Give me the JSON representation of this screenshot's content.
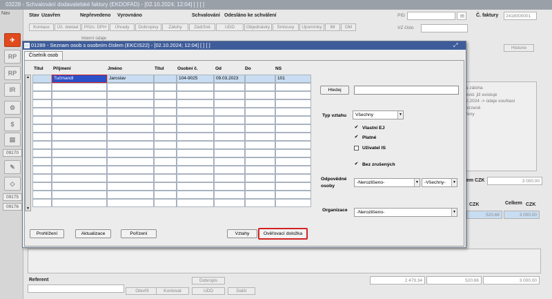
{
  "window_title": "03228 - Schvalování dodavatelské faktury (EKDOFAD) - [02.10.2024; 12:04] [ ] [ ]",
  "nav_label": "Nav",
  "nav_buttons": [
    "RP",
    "RP",
    "IR"
  ],
  "nav_numbers": [
    "09170",
    "09175",
    "09176"
  ],
  "status_labels": [
    "Stav",
    "Uzavřen",
    "Nepřevedeno",
    "Vyrovnáno",
    "Schvalování",
    "Odesláno ke schválení"
  ],
  "interni_udaje": "Interní údaje",
  "toolbar_buttons": [
    "Kontace",
    "Úč. doklad",
    "Přizn. DPH",
    "Úhrady",
    "Dobropisy",
    "Zálohy",
    "Zádržné",
    "UDD",
    "Objednávky",
    "Smlouvy",
    "Upomínky",
    "IM",
    "DM"
  ],
  "pid_label": "PID",
  "vz_label": "VZ číslo",
  "faktury_label": "Č. faktury",
  "faktury_value": "2418000001",
  "historie_button": "Historie",
  "right_notes": [
    "a záloha",
    "evid. již existuje",
    "2.2024 -> údaje souhlasí",
    "tvrzeně",
    "řeny"
  ],
  "czk_label": "em  CZK",
  "czk_value": "3 000.00",
  "bottom_czk": "CZK",
  "bottom_celkem": "Celkem",
  "bottom_celkem_czk": "CZK",
  "bottom_value_1": "520.66",
  "bottom_value_2": "3 000.00",
  "totals": [
    "2 479.34",
    "520.66",
    "3 000.00"
  ],
  "referent_label": "Referent",
  "bottom_buttons": [
    "Dobropis",
    "Otevřít",
    "Kontovat",
    "UDD",
    "Další"
  ],
  "modal": {
    "title": "01289 - Seznam osob s osobním číslem (EKCIS22) - [02.10.2024; 12:04] [ ] [ ]",
    "tab": "Číselník osob",
    "columns": [
      "Titul",
      "Příjmení",
      "Jméno",
      "Titul",
      "Osobní č.",
      "Od",
      "Do",
      "NS"
    ],
    "rows": [
      [
        "",
        "Tučmandl",
        "Jaroslav",
        "",
        "104-9025",
        "09.03.2023",
        "",
        "101"
      ]
    ],
    "empty_rows": 15,
    "hledej_button": "Hledej",
    "hledej_value": "",
    "typ_vztahu_label": "Typ vztahu",
    "typ_vztahu_value": "Všechny",
    "checkboxes": [
      {
        "label": "Vlastní EJ",
        "checked": true
      },
      {
        "label": "Platné",
        "checked": true
      },
      {
        "label": "Uživatel IS",
        "checked": false
      },
      {
        "label": "Bez zrušených",
        "checked": true
      }
    ],
    "odpovedne_label_1": "Odpovědné",
    "odpovedne_label_2": "osoby",
    "odpovedne_value_1": "-Nerozlišeno-",
    "odpovedne_value_2": "-Všechny-",
    "organizace_label": "Organizace",
    "organizace_value": "-Nerozlišeno-",
    "buttons": [
      "Prohlížení",
      "Aktualizace",
      "Pořízení",
      "Vztahy",
      "Ověřovací doložka"
    ],
    "highlight_color": "#d42020"
  }
}
